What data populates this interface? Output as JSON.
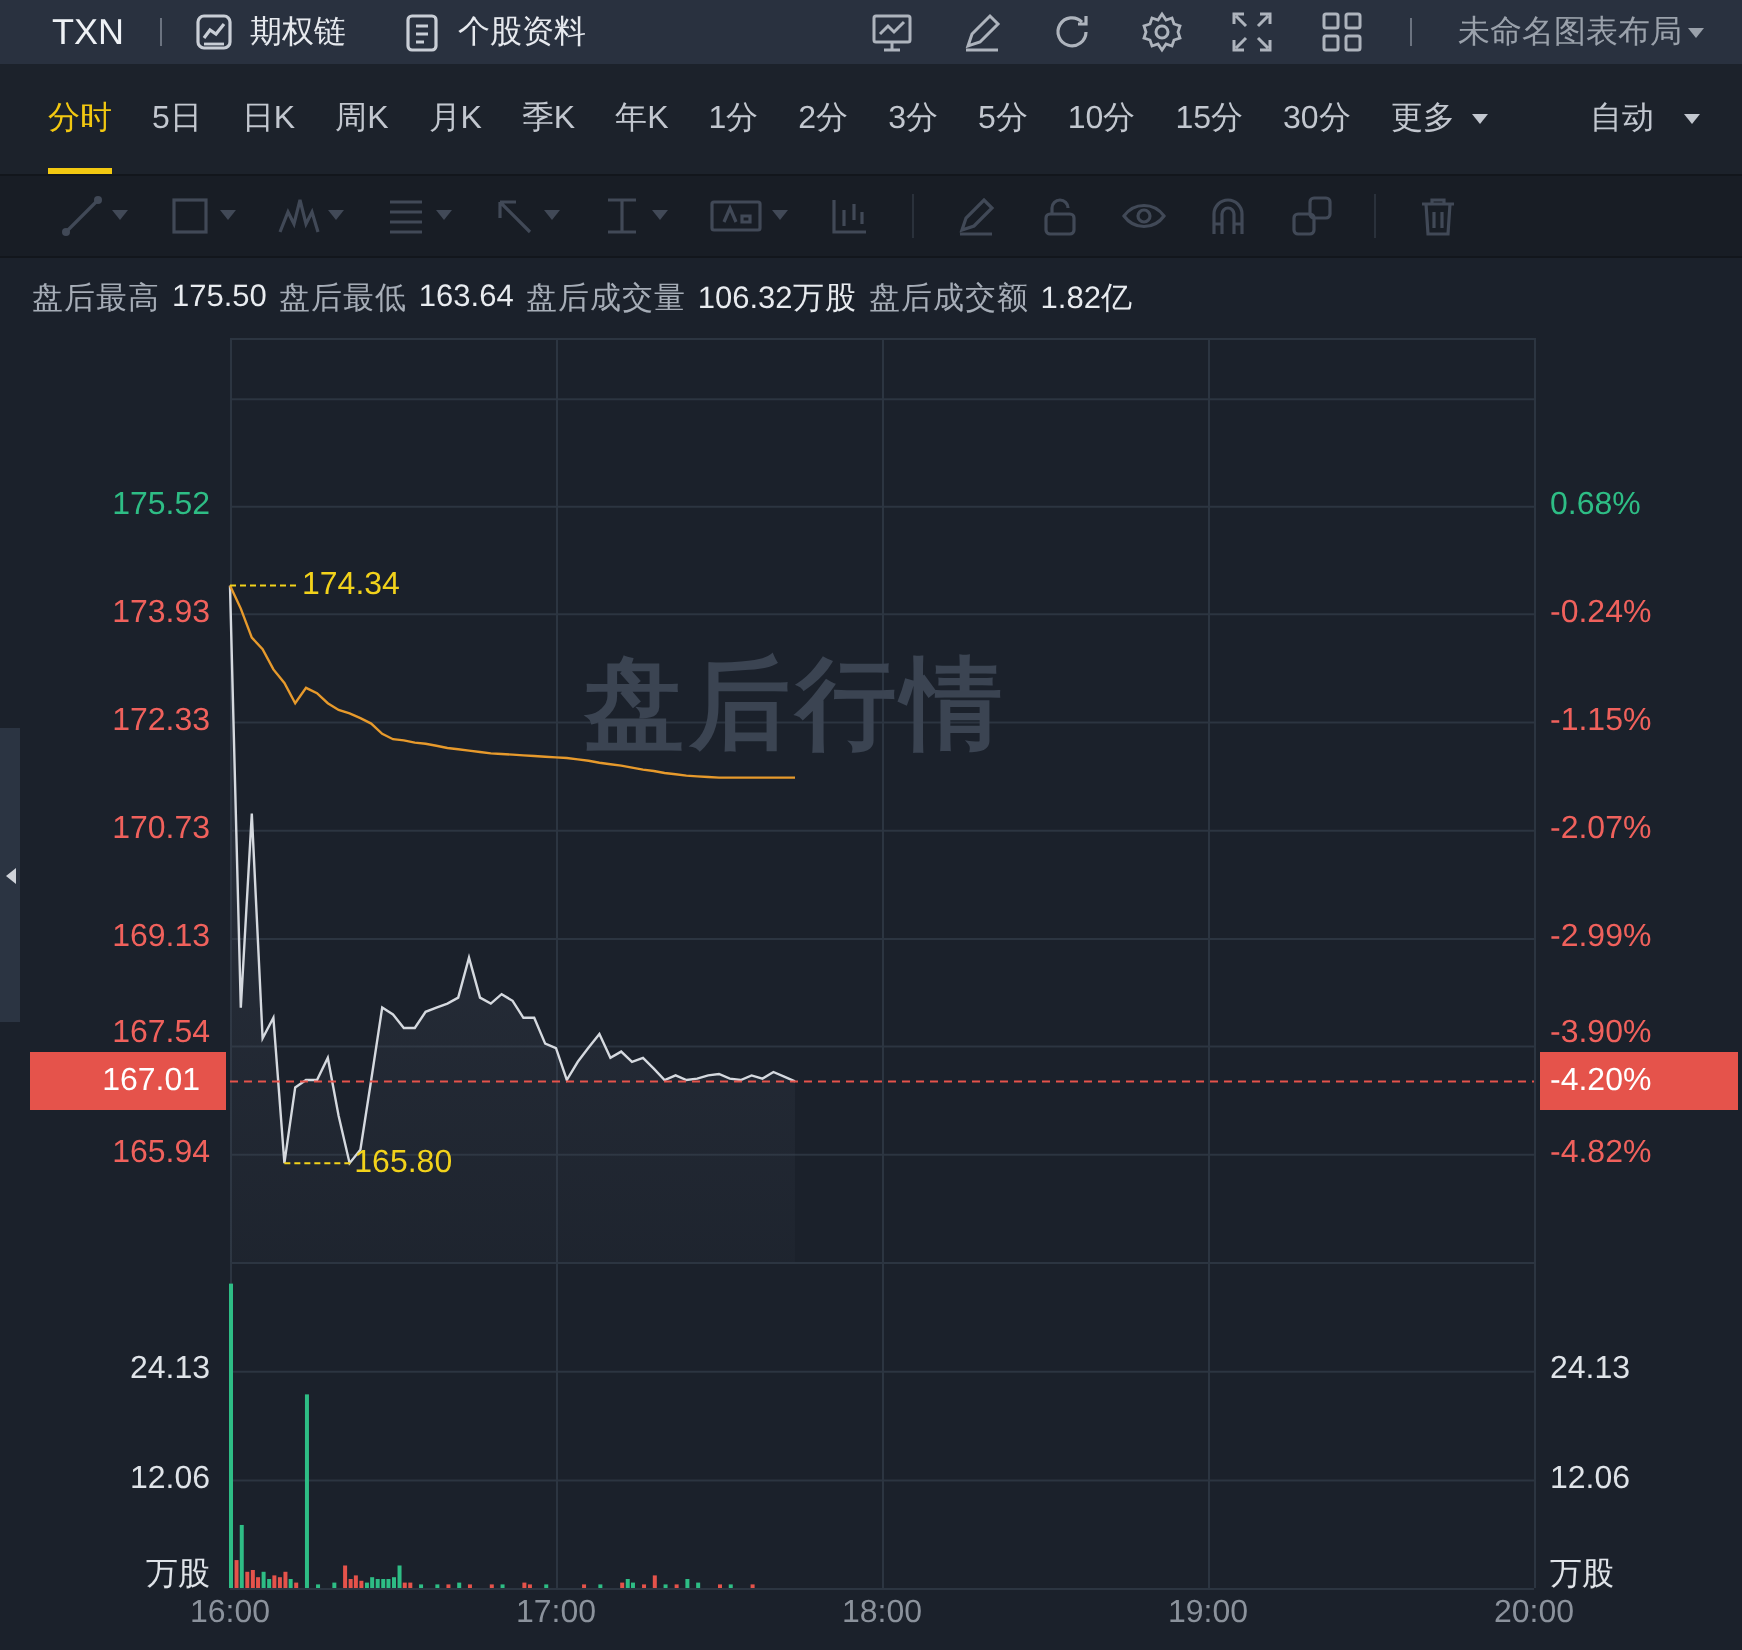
{
  "top_bar": {
    "symbol": "TXN",
    "links": [
      {
        "label": "期权链",
        "kind": "chart"
      },
      {
        "label": "个股资料",
        "kind": "doc"
      }
    ],
    "layout_menu": "未命名图表布局"
  },
  "period_tabs": [
    {
      "label": "分时",
      "selected": true
    },
    {
      "label": "5日",
      "selected": false
    },
    {
      "label": "日K",
      "selected": false
    },
    {
      "label": "周K",
      "selected": false
    },
    {
      "label": "月K",
      "selected": false
    },
    {
      "label": "季K",
      "selected": false
    },
    {
      "label": "年K",
      "selected": false
    },
    {
      "label": "1分",
      "selected": false
    },
    {
      "label": "2分",
      "selected": false
    },
    {
      "label": "3分",
      "selected": false
    },
    {
      "label": "5分",
      "selected": false
    },
    {
      "label": "10分",
      "selected": false
    },
    {
      "label": "15分",
      "selected": false
    },
    {
      "label": "30分",
      "selected": false
    },
    {
      "label": "更多",
      "selected": false,
      "kind": "dropdown"
    }
  ],
  "scale_menu": {
    "label": "自动"
  },
  "stats": [
    {
      "label": "盘后最高",
      "value": "175.50"
    },
    {
      "label": "盘后最低",
      "value": "163.64"
    },
    {
      "label": "盘后成交量",
      "value": "106.32万股"
    },
    {
      "label": "盘后成交额",
      "value": "1.82亿"
    }
  ],
  "session_label": "盘后行情",
  "price_chart": {
    "chart_data": {
      "type": "line",
      "grid": true,
      "ylim": [
        164.34,
        178.0
      ],
      "yticks": [
        {
          "value": 175.52,
          "label": "175.52"
        },
        {
          "value": 173.93,
          "label": "173.93"
        },
        {
          "value": 172.33,
          "label": "172.33"
        },
        {
          "value": 170.73,
          "label": "170.73"
        },
        {
          "value": 169.13,
          "label": "169.13"
        },
        {
          "value": 167.54,
          "label": "167.54"
        },
        {
          "value": 165.94,
          "label": "165.94"
        }
      ],
      "categories": [
        null,
        null,
        null,
        null,
        null,
        null,
        null,
        null,
        null,
        null,
        null,
        null,
        null,
        null,
        null,
        null,
        null,
        null,
        null,
        null,
        null,
        null,
        null,
        null,
        null,
        null,
        null,
        null,
        null,
        null,
        null,
        null,
        null,
        null,
        null,
        null,
        null,
        null,
        null,
        null,
        null,
        null,
        null,
        null,
        null,
        null,
        null,
        null,
        null,
        null,
        null,
        null,
        null,
        null,
        null,
        null,
        null,
        null,
        null,
        null,
        null,
        null,
        null,
        null,
        null,
        null,
        null,
        null,
        null,
        null,
        null,
        null,
        null,
        null,
        null,
        null,
        null,
        null,
        null,
        null,
        null,
        null,
        null,
        null,
        null,
        null,
        null,
        null,
        null,
        null,
        null,
        null,
        null,
        null,
        null,
        null,
        null,
        null,
        null,
        null,
        null,
        null,
        null,
        null,
        null,
        null,
        null,
        null,
        null,
        null,
        null,
        null,
        null,
        null,
        null,
        null,
        null,
        null,
        null,
        null,
        null
      ],
      "series": [
        {
          "color": "#d5d9df",
          "values": [
            174.34,
            168.1,
            170.97,
            167.65,
            167.95,
            165.8,
            166.92,
            167.03,
            167.03,
            167.36,
            166.5,
            165.8,
            166.0,
            167.03,
            168.1,
            168.0,
            167.8,
            167.8,
            168.04,
            168.1,
            168.16,
            168.25,
            168.84,
            168.25,
            168.16,
            168.3,
            168.2,
            167.95,
            167.95,
            167.57,
            167.5,
            167.03,
            167.3,
            167.51,
            167.71,
            167.36,
            167.45,
            167.3,
            167.36,
            167.2,
            167.03,
            167.1,
            167.03,
            167.05,
            167.1,
            167.12,
            167.05,
            167.03,
            167.1,
            167.05,
            167.15,
            167.08,
            167.01,
            null,
            null,
            null,
            null,
            null,
            null,
            null,
            null,
            null,
            null,
            null,
            null,
            null,
            null,
            null,
            null,
            null,
            null,
            null,
            null,
            null,
            null,
            null,
            null,
            null,
            null,
            null,
            null,
            null,
            null,
            null,
            null,
            null,
            null,
            null,
            null,
            null,
            null,
            null,
            null,
            null,
            null,
            null,
            null,
            null,
            null,
            null,
            null,
            null,
            null,
            null,
            null,
            null,
            null,
            null,
            null,
            null,
            null,
            null,
            null,
            null,
            null,
            null,
            null,
            null,
            null,
            null,
            null
          ]
        },
        {
          "color": "#e79a2c",
          "values": [
            174.34,
            174.0,
            173.57,
            173.4,
            173.1,
            172.9,
            172.6,
            172.83,
            172.75,
            172.6,
            172.5,
            172.45,
            172.38,
            172.3,
            172.15,
            172.07,
            172.05,
            172.02,
            172.0,
            171.97,
            171.94,
            171.92,
            171.9,
            171.88,
            171.86,
            171.85,
            171.84,
            171.83,
            171.82,
            171.81,
            171.8,
            171.79,
            171.77,
            171.75,
            171.72,
            171.7,
            171.68,
            171.65,
            171.62,
            171.6,
            171.57,
            171.55,
            171.53,
            171.52,
            171.51,
            171.5,
            171.5,
            171.5,
            171.5,
            171.5,
            171.5,
            171.5,
            171.5,
            null,
            null,
            null,
            null,
            null,
            null,
            null,
            null,
            null,
            null,
            null,
            null,
            null,
            null,
            null,
            null,
            null,
            null,
            null,
            null,
            null,
            null,
            null,
            null,
            null,
            null,
            null,
            null,
            null,
            null,
            null,
            null,
            null,
            null,
            null,
            null,
            null,
            null,
            null,
            null,
            null,
            null,
            null,
            null,
            null,
            null,
            null,
            null,
            null,
            null,
            null,
            null,
            null,
            null,
            null,
            null,
            null,
            null,
            null,
            null,
            null,
            null,
            null,
            null,
            null,
            null,
            null,
            null
          ]
        }
      ]
    },
    "markers": [
      {
        "kind": "high",
        "label": "174.34"
      },
      {
        "kind": "low",
        "label": "165.80"
      }
    ],
    "last_price": {
      "price": "167.01",
      "change": "-4.20%"
    },
    "axis_rows": [
      {
        "change": "0.68%",
        "color": "#2ebd85"
      },
      {
        "change": "-0.24%",
        "color": "#f0615c"
      },
      {
        "change": "-1.15%",
        "color": "#f0615c"
      },
      {
        "change": "-2.07%",
        "color": "#f0615c"
      },
      {
        "change": "-2.99%",
        "color": "#f0615c"
      },
      {
        "change": "-3.90%",
        "color": "#f0615c"
      },
      {
        "change": "-4.82%",
        "color": "#f0615c"
      }
    ]
  },
  "volume_chart": {
    "chart_data": {
      "type": "bar",
      "grid": true,
      "xlim": [
        16,
        20
      ],
      "ylim": [
        0,
        36.2
      ],
      "yticks": [
        {
          "value": 24.13,
          "label": "24.13"
        },
        {
          "value": 12.06,
          "label": "12.06"
        }
      ],
      "xticks": [
        {
          "value": 16,
          "label": "16:00"
        },
        {
          "value": 17,
          "label": "17:00"
        },
        {
          "value": 18,
          "label": "18:00"
        },
        {
          "value": 19,
          "label": "19:00"
        },
        {
          "value": 20,
          "label": "20:00"
        }
      ],
      "x": [
        16,
        16.017,
        16.033,
        16.05,
        16.067,
        16.083,
        16.1,
        16.117,
        16.133,
        16.15,
        16.167,
        16.183,
        16.2,
        16.233,
        16.267,
        16.317,
        16.35,
        16.367,
        16.383,
        16.4,
        16.417,
        16.433,
        16.45,
        16.467,
        16.483,
        16.5,
        16.517,
        16.533,
        16.55,
        16.583,
        16.633,
        16.667,
        16.7,
        16.733,
        16.8,
        16.833,
        16.9,
        16.917,
        16.967,
        17.083,
        17.133,
        17.2,
        17.217,
        17.233,
        17.267,
        17.3,
        17.333,
        17.367,
        17.4,
        17.433,
        17.5,
        17.533,
        17.6
      ],
      "series": [
        {
          "color": "#e5534b",
          "values": [
            null,
            3.1,
            null,
            1.8,
            2.0,
            1.2,
            null,
            null,
            1.4,
            1.2,
            1.8,
            null,
            0.6,
            null,
            null,
            null,
            2.5,
            1.0,
            1.4,
            0.8,
            null,
            null,
            null,
            null,
            null,
            null,
            null,
            0.6,
            0.6,
            null,
            null,
            0.4,
            null,
            0.4,
            0.4,
            null,
            0.6,
            0.4,
            null,
            0.4,
            null,
            0.6,
            null,
            null,
            0.4,
            1.4,
            null,
            0.4,
            null,
            null,
            0.4,
            null,
            0.4
          ]
        },
        {
          "color": "#2ebd85",
          "values": [
            33.8,
            null,
            7.0,
            null,
            null,
            null,
            1.8,
            1.0,
            null,
            null,
            null,
            1.0,
            null,
            21.5,
            0.4,
            0.6,
            null,
            null,
            null,
            null,
            0.6,
            1.2,
            1.0,
            1.0,
            1.0,
            1.2,
            2.5,
            null,
            null,
            0.4,
            0.4,
            null,
            0.6,
            null,
            null,
            0.4,
            null,
            null,
            0.4,
            null,
            0.4,
            null,
            1.0,
            0.6,
            null,
            null,
            0.4,
            null,
            1.0,
            0.6,
            null,
            0.4,
            null
          ]
        }
      ]
    },
    "right_yticks": [
      "24.13",
      "12.06"
    ],
    "unit_labels": [
      "万股",
      "万股"
    ]
  }
}
